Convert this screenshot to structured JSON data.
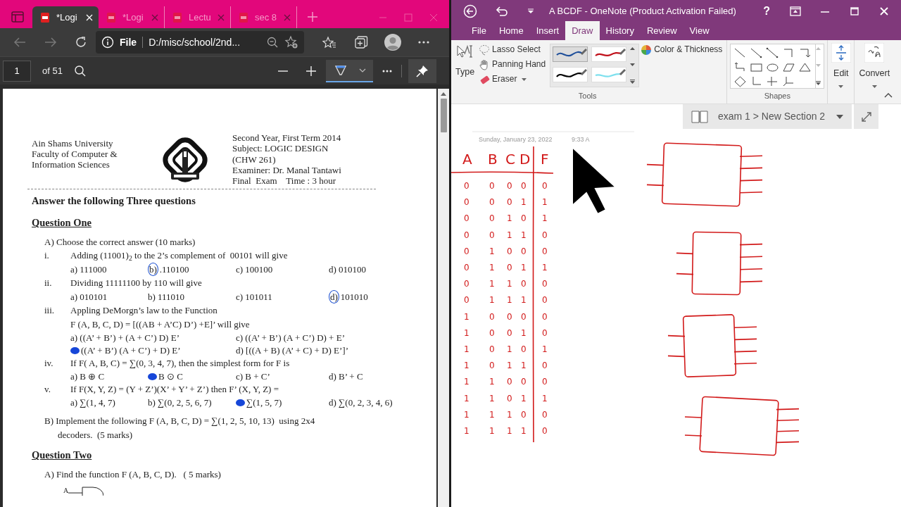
{
  "browser": {
    "tabs": [
      {
        "label": "*Logi",
        "selected": true
      },
      {
        "label": "*Logi",
        "selected": false
      },
      {
        "label": "Lectu",
        "selected": false
      },
      {
        "label": "sec 8",
        "selected": false
      }
    ],
    "address": {
      "scheme": "File",
      "url": "D:/misc/school/2nd..."
    },
    "pdf_toolbar": {
      "page": "1",
      "page_count": "of 51"
    }
  },
  "document": {
    "university": [
      "Ain Shams University",
      "Faculty of Computer &",
      "Information Sciences"
    ],
    "exam_info": [
      "Second Year, First Term 2014",
      "Subject: LOGIC DESIGN",
      "(CHW 261)",
      "Examiner: Dr. Manal Tantawi",
      "Final  Exam    Time : 3 hour"
    ],
    "instruction": "Answer the following Three questions",
    "blocks": [
      {
        "kind": "heading",
        "text": "Question One"
      },
      {
        "kind": "part",
        "text": "A) Choose the correct answer (10 marks)"
      },
      {
        "kind": "item",
        "numeral": "i.",
        "text": "Adding (11001)$_{2}$ to the 2’s complement of  00101 will give",
        "options": [
          {
            "kind": "plain",
            "label": "a)",
            "text": "111000"
          },
          {
            "kind": "circled",
            "label": "b)",
            "text": ".110100"
          },
          {
            "kind": "plain",
            "label": "c)",
            "text": "100100"
          },
          {
            "kind": "plain",
            "label": "d)",
            "text": "010100"
          }
        ]
      },
      {
        "kind": "item",
        "numeral": "ii.",
        "text": "Dividing 11111100 by 110 will give",
        "options": [
          {
            "kind": "plain",
            "label": "a)",
            "text": "010101"
          },
          {
            "kind": "plain",
            "label": "b)",
            "text": "111010"
          },
          {
            "kind": "plain",
            "label": "c)",
            "text": "101011"
          },
          {
            "kind": "circled",
            "label": "d)",
            "text": "101010"
          }
        ]
      },
      {
        "kind": "item_paired",
        "numeral": "iii.",
        "text": "Appling DeMorgn’s law to the Function",
        "continuation": "F (A, B, C, D) = [((AB + A’C) D’) +E]’ will give",
        "options": [
          {
            "kind": "plain",
            "label": "a)",
            "text": "((A’ + B’) + (A + C’) D) E’"
          },
          {
            "kind": "plain",
            "label": "c)",
            "text": "((A’ + B’) (A + C’) D) + E’"
          },
          {
            "kind": "dotted",
            "text": "((A’ + B’) (A + C’) + D) E’"
          },
          {
            "kind": "plain",
            "label": "d)",
            "text": "[((A + B) (A’ + C) + D) E’]’"
          }
        ]
      },
      {
        "kind": "item",
        "numeral": "iv.",
        "text": "If F( A, B, C) = ∑(0, 3, 4, 7), then the simplest form for F is",
        "options": [
          {
            "kind": "plain",
            "label": "a)",
            "text": "B ⊕ C"
          },
          {
            "kind": "dotted",
            "text": "B ⊙ C"
          },
          {
            "kind": "plain",
            "label": "c)",
            "text": "B + C’"
          },
          {
            "kind": "plain",
            "label": "d)",
            "text": "B’ + C"
          }
        ]
      },
      {
        "kind": "item",
        "numeral": "v.",
        "text": "If F(X, Y, Z) = (Y + Z’)(X’ + Y’ + Z’) then F’ (X, Y, Z) =",
        "options": [
          {
            "kind": "plain",
            "label": "a)",
            "text": "∑(1, 4, 7)"
          },
          {
            "kind": "plain",
            "label": "b)",
            "text": "∑(0, 2, 5, 6, 7)"
          },
          {
            "kind": "dotted",
            "text": "∑(1, 5, 7)"
          },
          {
            "kind": "plain",
            "label": "d)",
            "text": "∑(0, 2, 3, 4, 6)"
          }
        ]
      },
      {
        "kind": "part",
        "text": "B) Implement the following F (A, B, C, D) = ∑(1, 2, 5, 10, 13)  using 2x4",
        "continuation": "decoders.  (5 marks)"
      },
      {
        "kind": "heading",
        "text": "Question Two"
      },
      {
        "kind": "part",
        "text": "A) Find the function F (A, B, C, D).   ( 5 marks)"
      },
      {
        "kind": "circuit",
        "text": "A"
      }
    ]
  },
  "onenote": {
    "title": "A BCDF - OneNote (Product Activation Failed)",
    "help": "?",
    "menu_tabs": [
      {
        "label": "File",
        "selected": false
      },
      {
        "label": "Home",
        "selected": false
      },
      {
        "label": "Insert",
        "selected": false
      },
      {
        "label": "Draw",
        "selected": true
      },
      {
        "label": "History",
        "selected": false
      },
      {
        "label": "Review",
        "selected": false
      },
      {
        "label": "View",
        "selected": false
      }
    ],
    "ribbon": {
      "type_label": "Type",
      "tools": [
        {
          "label": "Lasso Select",
          "kind": "lasso"
        },
        {
          "label": "Panning Hand",
          "kind": "hand"
        },
        {
          "label": "Eraser",
          "kind": "eraser"
        }
      ],
      "pens": [
        {
          "color": "#1f4f9a",
          "selected": true
        },
        {
          "color": "#c0101a",
          "selected": false
        },
        {
          "color": "#000000",
          "selected": false
        },
        {
          "color": "#7ee0ee",
          "selected": false
        }
      ],
      "color_thickness": "Color & Thickness",
      "tools_group": "Tools",
      "shapes_group": "Shapes",
      "edit": "Edit",
      "convert": "Convert"
    },
    "notebook_path": "exam 1 > New Section 2",
    "page": {
      "date": "Sunday, January 23, 2022",
      "time": "9:33 A",
      "truth_table": {
        "columns": [
          "A",
          "B",
          "C",
          "D",
          "F"
        ],
        "rows": [
          [
            "0",
            "0",
            "0",
            "0",
            "0"
          ],
          [
            "0",
            "0",
            "0",
            "1",
            "1"
          ],
          [
            "0",
            "0",
            "1",
            "0",
            "1"
          ],
          [
            "0",
            "0",
            "1",
            "1",
            "0"
          ],
          [
            "0",
            "1",
            "0",
            "0",
            "0"
          ],
          [
            "0",
            "1",
            "0",
            "1",
            "1"
          ],
          [
            "0",
            "1",
            "1",
            "0",
            "0"
          ],
          [
            "0",
            "1",
            "1",
            "1",
            "0"
          ],
          [
            "1",
            "0",
            "0",
            "0",
            "0"
          ],
          [
            "1",
            "0",
            "0",
            "1",
            "0"
          ],
          [
            "1",
            "0",
            "1",
            "0",
            "1"
          ],
          [
            "1",
            "0",
            "1",
            "1",
            "0"
          ],
          [
            "1",
            "1",
            "0",
            "0",
            "0"
          ],
          [
            "1",
            "1",
            "0",
            "1",
            "1"
          ],
          [
            "1",
            "1",
            "1",
            "0",
            "0"
          ],
          [
            "1",
            "1",
            "1",
            "1",
            "0"
          ]
        ]
      }
    }
  }
}
